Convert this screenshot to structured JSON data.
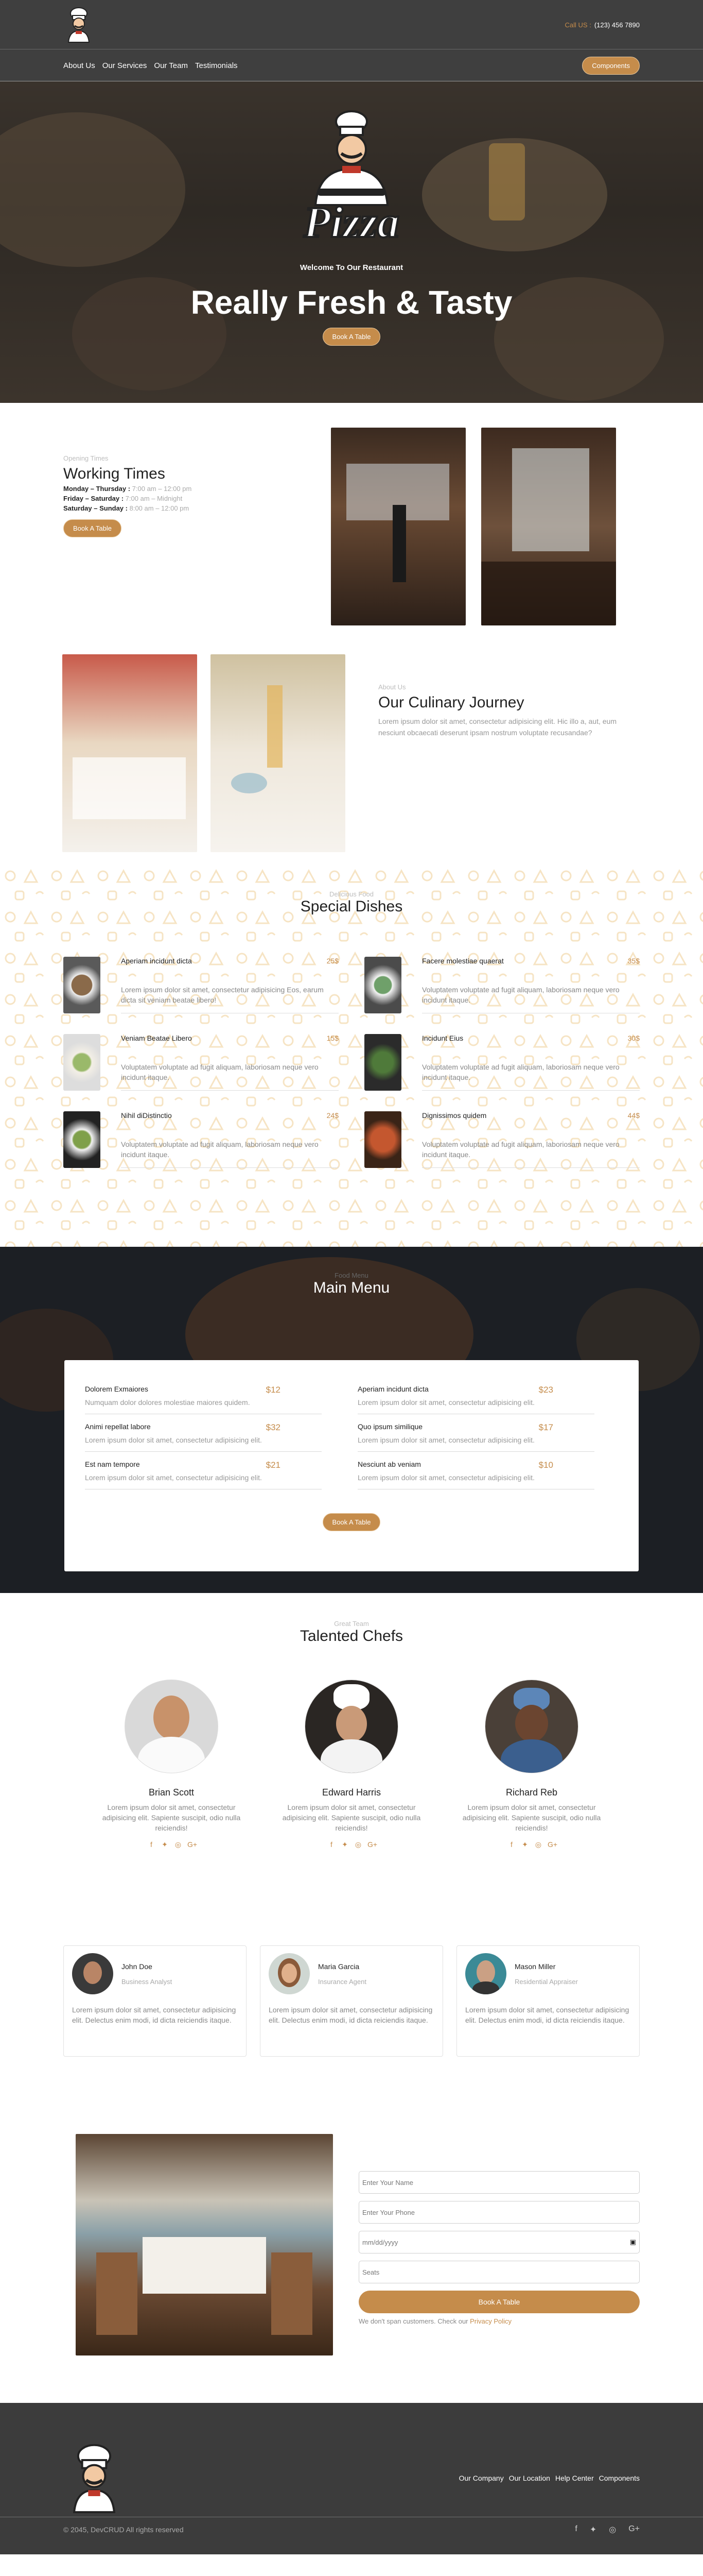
{
  "header": {
    "call_label": "Call US :",
    "phone": "(123) 456 7890"
  },
  "nav": {
    "links": [
      "About Us",
      "Our Services",
      "Our Team",
      "Testimonials"
    ],
    "components_label": "Components"
  },
  "hero": {
    "logo_word": "Pizza",
    "subtitle": "Welcome To Our Restaurant",
    "title": "Really Fresh & Tasty",
    "button": "Book A Table"
  },
  "working_times": {
    "kicker": "Opening Times",
    "title": "Working Times",
    "lines": [
      {
        "days": "Monday – Thursday :",
        "time": "7:00 am – 12:00 pm"
      },
      {
        "days": "Friday – Saturday :",
        "time": "7:00 am – Midnight"
      },
      {
        "days": "Saturday – Sunday :",
        "time": "8:00 am – 12:00 pm"
      }
    ],
    "button": "Book A Table"
  },
  "journey": {
    "kicker": "About Us",
    "title": "Our Culinary Journey",
    "text": "Lorem ipsum dolor sit amet, consectetur adipisicing elit. Hic illo a, aut, eum nesciunt obcaecati deserunt ipsam nostrum voluptate recusandae?"
  },
  "special": {
    "kicker": "Delicious Food",
    "title": "Special Dishes",
    "dishes": [
      {
        "name": "Aperiam incidunt dicta",
        "price": "25$",
        "desc": "Lorem ipsum dolor sit amet, consectetur adipisicing Eos, earum dicta sit veniam beatae libero!"
      },
      {
        "name": "Facere molestiae quaerat",
        "price": "35$",
        "desc": "Voluptatem voluptate ad fugit aliquam, laboriosam neque vero incidunt itaque."
      },
      {
        "name": "Veniam Beatae Libero",
        "price": "15$",
        "desc": "Voluptatem voluptate ad fugit aliquam, laboriosam neque vero incidunt itaque."
      },
      {
        "name": "Incidunt Eius",
        "price": "30$",
        "desc": "Voluptatem voluptate ad fugit aliquam, laboriosam neque vero incidunt itaque."
      },
      {
        "name": "Nihil diDistinctio",
        "price": "24$",
        "desc": "Voluptatem voluptate ad fugit aliquam, laboriosam neque vero incidunt itaque."
      },
      {
        "name": "Dignissimos quidem",
        "price": "44$",
        "desc": "Voluptatem voluptate ad fugit aliquam, laboriosam neque vero incidunt itaque."
      }
    ]
  },
  "main_menu": {
    "kicker": "Food Menu",
    "title": "Main Menu",
    "items": [
      {
        "name": "Dolorem Exmaiores",
        "price": "$12",
        "desc": "Numquam dolor dolores molestiae maiores quidem."
      },
      {
        "name": "Aperiam incidunt dicta",
        "price": "$23",
        "desc": "Lorem ipsum dolor sit amet, consectetur adipisicing elit."
      },
      {
        "name": "Animi repellat labore",
        "price": "$32",
        "desc": "Lorem ipsum dolor sit amet, consectetur adipisicing elit."
      },
      {
        "name": "Quo ipsum similique",
        "price": "$17",
        "desc": "Lorem ipsum dolor sit amet, consectetur adipisicing elit."
      },
      {
        "name": "Est nam tempore",
        "price": "$21",
        "desc": "Lorem ipsum dolor sit amet, consectetur adipisicing elit."
      },
      {
        "name": "Nesciunt ab veniam",
        "price": "$10",
        "desc": "Lorem ipsum dolor sit amet, consectetur adipisicing elit."
      }
    ],
    "button": "Book A Table"
  },
  "chefs": {
    "kicker": "Great Team",
    "title": "Talented Chefs",
    "list": [
      {
        "name": "Brian Scott",
        "desc": "Lorem ipsum dolor sit amet, consectetur adipisicing elit. Sapiente suscipit, odio nulla reiciendis!"
      },
      {
        "name": "Edward Harris",
        "desc": "Lorem ipsum dolor sit amet, consectetur adipisicing elit. Sapiente suscipit, odio nulla reiciendis!"
      },
      {
        "name": "Richard Reb",
        "desc": "Lorem ipsum dolor sit amet, consectetur adipisicing elit. Sapiente suscipit, odio nulla reiciendis!"
      }
    ]
  },
  "testimonials": [
    {
      "name": "John Doe",
      "role": "Business Analyst",
      "text": "Lorem ipsum dolor sit amet, consectetur adipisicing elit. Delectus enim modi, id dicta reiciendis itaque."
    },
    {
      "name": "Maria Garcia",
      "role": "Insurance Agent",
      "text": "Lorem ipsum dolor sit amet, consectetur adipisicing elit. Delectus enim modi, id dicta reiciendis itaque."
    },
    {
      "name": "Mason Miller",
      "role": "Residential Appraiser",
      "text": "Lorem ipsum dolor sit amet, consectetur adipisicing elit. Delectus enim modi, id dicta reiciendis itaque."
    }
  ],
  "booking": {
    "name_placeholder": "Enter Your Name",
    "phone_placeholder": "Enter Your Phone",
    "date_placeholder": "mm/dd/yyyy",
    "seats_placeholder": "Seats",
    "button": "Book A Table",
    "note": "We don't span customers. Check our",
    "policy": "Privacy Policy"
  },
  "footer": {
    "links": [
      "Our Company",
      "Our Location",
      "Help Center",
      "Components"
    ],
    "copyright": "© 2045, DevCRUD All rights reserved"
  },
  "colors": {
    "accent": "#c58c4b",
    "dark": "#3f3f3f"
  }
}
